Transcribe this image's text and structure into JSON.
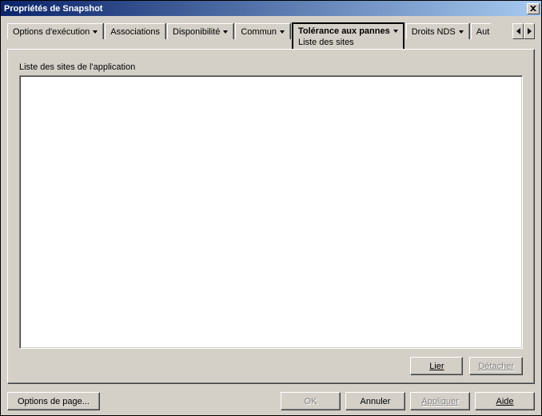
{
  "window": {
    "title": "Propriétés de Snapshot"
  },
  "tabs": {
    "items": [
      {
        "label": "Options d'exécution"
      },
      {
        "label": "Associations"
      },
      {
        "label": "Disponibilité"
      },
      {
        "label": "Commun"
      },
      {
        "label": "Tolérance aux pannes",
        "subtab": "Liste des sites"
      },
      {
        "label": "Droits NDS"
      },
      {
        "label": "Aut"
      }
    ]
  },
  "panel": {
    "group_label": "Liste des sites de l'application",
    "link_button": "Lier",
    "detach_button": "Détacher"
  },
  "footer": {
    "page_options": "Options de page...",
    "ok": "OK",
    "cancel": "Annuler",
    "apply": "Appliquer",
    "help": "Aide"
  }
}
